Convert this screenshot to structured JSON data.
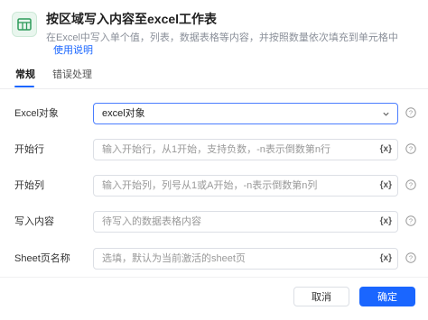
{
  "header": {
    "title": "按区域写入内容至excel工作表",
    "description": "在Excel中写入单个值，列表，数据表格等内容，并按照数量依次填充到单元格中",
    "help_link": "使用说明",
    "icon": "excel-table-icon"
  },
  "tabs": [
    {
      "label": "常规",
      "active": true
    },
    {
      "label": "错误处理",
      "active": false
    }
  ],
  "form": {
    "excel_object": {
      "label": "Excel对象",
      "value": "excel对象"
    },
    "start_row": {
      "label": "开始行",
      "placeholder": "输入开始行，从1开始，支持负数，-n表示倒数第n行"
    },
    "start_column": {
      "label": "开始列",
      "placeholder": "输入开始列，列号从1或A开始，-n表示倒数第n列"
    },
    "write_content": {
      "label": "写入内容",
      "placeholder": "待写入的数据表格内容"
    },
    "sheet_name": {
      "label": "Sheet页名称",
      "placeholder": "选填，默认为当前激活的sheet页"
    },
    "variable_symbol": "{x}"
  },
  "footer": {
    "cancel_label": "取消",
    "confirm_label": "确定"
  },
  "colors": {
    "accent": "#1a66ff",
    "icon_green": "#2e9b5a"
  }
}
